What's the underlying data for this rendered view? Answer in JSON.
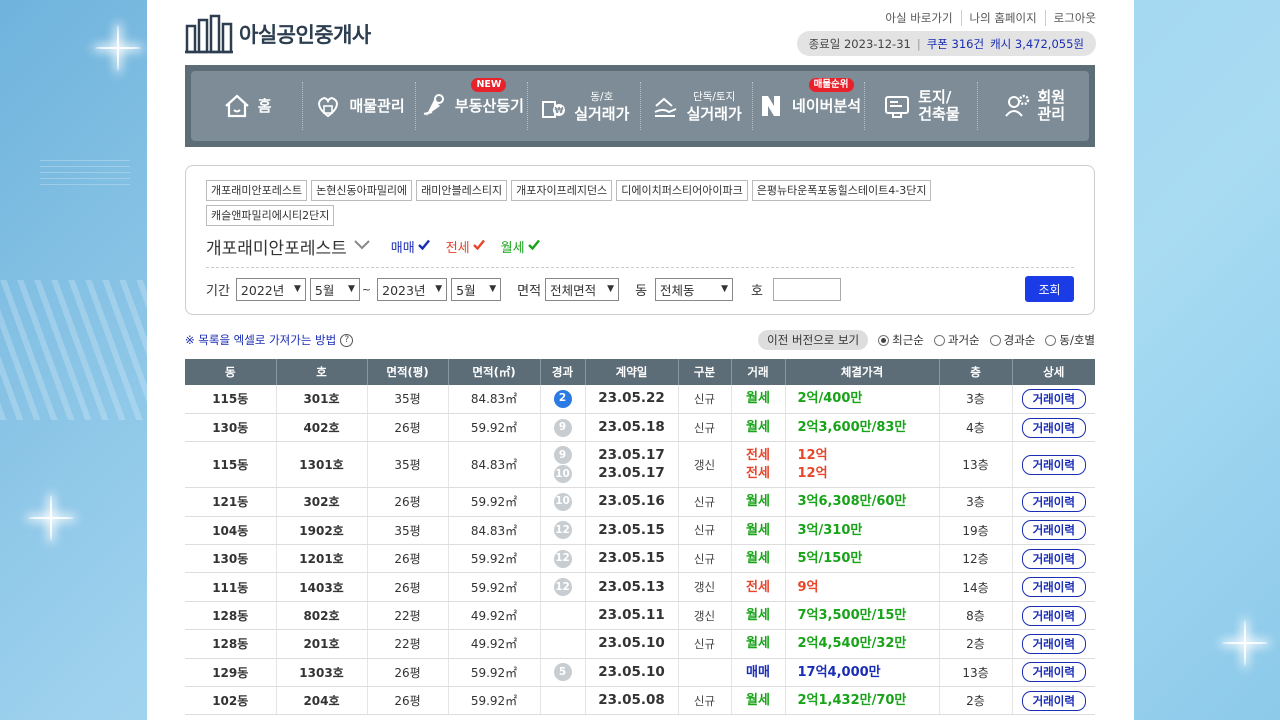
{
  "header": {
    "logo_text": "아실공인중개사",
    "links": [
      "아실 바로가기",
      "나의 홈페이지",
      "로그아웃"
    ],
    "expire_label": "종료일 2023-12-31",
    "coupon": "쿠폰 316건",
    "cash": "캐시 3,472,055원"
  },
  "nav": {
    "items": [
      {
        "label": "홈",
        "icon": "home-icon"
      },
      {
        "label": "매물관리",
        "icon": "house-heart-icon"
      },
      {
        "label": "부동산등기",
        "icon": "registry-icon",
        "badge": "NEW"
      },
      {
        "label": "실거래가",
        "small": "동/호",
        "icon": "building-money-icon"
      },
      {
        "label": "실거래가",
        "small": "단독/토지",
        "icon": "land-hand-icon"
      },
      {
        "label": "네이버분석",
        "icon": "naver-icon",
        "badge": "매물순위"
      },
      {
        "label": "토지/\n건축물",
        "icon": "document-icon"
      },
      {
        "label": "회원\n관리",
        "icon": "member-gear-icon"
      }
    ]
  },
  "filter": {
    "chips": [
      "개포래미안포레스트",
      "논현신동아파밀리에",
      "래미안블레스티지",
      "개포자이프레지던스",
      "디에이치퍼스티어아이파크",
      "은평뉴타운폭포동힐스테이트4-3단지",
      "캐슬앤파밀리에시티2단지"
    ],
    "selected_name": "개포래미안포레스트",
    "trade_types": [
      {
        "label": "매매",
        "color": "#1a2db5"
      },
      {
        "label": "전세",
        "color": "#e8452b"
      },
      {
        "label": "월세",
        "color": "#18a318"
      }
    ],
    "period_label": "기간",
    "from_year": "2022년",
    "from_month": "5월",
    "tilde": "~",
    "to_year": "2023년",
    "to_month": "5월",
    "area_label": "면적",
    "area_value": "전체면적",
    "dong_label": "동",
    "dong_value": "전체동",
    "ho_label": "호",
    "ho_value": "",
    "search_button": "조회"
  },
  "listbar": {
    "excel_link": "※ 목록을 엑셀로 가져가는 방법",
    "prev_version": "이전 버전으로 보기",
    "sorts": [
      {
        "label": "최근순",
        "checked": true
      },
      {
        "label": "과거순",
        "checked": false
      },
      {
        "label": "경과순",
        "checked": false
      },
      {
        "label": "동/호별",
        "checked": false
      }
    ]
  },
  "table": {
    "headers": [
      "동",
      "호",
      "면적(평)",
      "면적(㎡)",
      "경과",
      "계약일",
      "구분",
      "거래",
      "체결가격",
      "층",
      "상세"
    ],
    "detail_label": "거래이력",
    "rows": [
      {
        "dong": "115동",
        "ho": "301호",
        "py": "35평",
        "m2": "84.83㎡",
        "elapsed": [
          "2"
        ],
        "elapsed_blue": true,
        "date": [
          "23.05.22"
        ],
        "gubun": "신규",
        "trade": [
          "월세"
        ],
        "price": [
          "2억/400만"
        ],
        "floor": "3층"
      },
      {
        "dong": "130동",
        "ho": "402호",
        "py": "26평",
        "m2": "59.92㎡",
        "elapsed": [
          "9"
        ],
        "date": [
          "23.05.18"
        ],
        "gubun": "신규",
        "trade": [
          "월세"
        ],
        "price": [
          "2억3,600만/83만"
        ],
        "floor": "4층"
      },
      {
        "dong": "115동",
        "ho": "1301호",
        "py": "35평",
        "m2": "84.83㎡",
        "elapsed": [
          "9",
          "10"
        ],
        "date": [
          "23.05.17",
          "23.05.17"
        ],
        "gubun": "갱신",
        "trade": [
          "전세",
          "전세"
        ],
        "price": [
          "12억",
          "12억"
        ],
        "floor": "13층"
      },
      {
        "dong": "121동",
        "ho": "302호",
        "py": "26평",
        "m2": "59.92㎡",
        "elapsed": [
          "10"
        ],
        "date": [
          "23.05.16"
        ],
        "gubun": "신규",
        "trade": [
          "월세"
        ],
        "price": [
          "3억6,308만/60만"
        ],
        "floor": "3층"
      },
      {
        "dong": "104동",
        "ho": "1902호",
        "py": "35평",
        "m2": "84.83㎡",
        "elapsed": [
          "12"
        ],
        "date": [
          "23.05.15"
        ],
        "gubun": "신규",
        "trade": [
          "월세"
        ],
        "price": [
          "3억/310만"
        ],
        "floor": "19층"
      },
      {
        "dong": "130동",
        "ho": "1201호",
        "py": "26평",
        "m2": "59.92㎡",
        "elapsed": [
          "12"
        ],
        "date": [
          "23.05.15"
        ],
        "gubun": "신규",
        "trade": [
          "월세"
        ],
        "price": [
          "5억/150만"
        ],
        "floor": "12층"
      },
      {
        "dong": "111동",
        "ho": "1403호",
        "py": "26평",
        "m2": "59.92㎡",
        "elapsed": [
          "12"
        ],
        "date": [
          "23.05.13"
        ],
        "gubun": "갱신",
        "trade": [
          "전세"
        ],
        "price": [
          "9억"
        ],
        "floor": "14층"
      },
      {
        "dong": "128동",
        "ho": "802호",
        "py": "22평",
        "m2": "49.92㎡",
        "elapsed": [],
        "date": [
          "23.05.11"
        ],
        "gubun": "갱신",
        "trade": [
          "월세"
        ],
        "price": [
          "7억3,500만/15만"
        ],
        "floor": "8층"
      },
      {
        "dong": "128동",
        "ho": "201호",
        "py": "22평",
        "m2": "49.92㎡",
        "elapsed": [],
        "date": [
          "23.05.10"
        ],
        "gubun": "신규",
        "trade": [
          "월세"
        ],
        "price": [
          "2억4,540만/32만"
        ],
        "floor": "2층"
      },
      {
        "dong": "129동",
        "ho": "1303호",
        "py": "26평",
        "m2": "59.92㎡",
        "elapsed": [
          "5"
        ],
        "date": [
          "23.05.10"
        ],
        "gubun": "",
        "trade": [
          "매매"
        ],
        "price": [
          "17억4,000만"
        ],
        "floor": "13층"
      },
      {
        "dong": "102동",
        "ho": "204호",
        "py": "26평",
        "m2": "59.92㎡",
        "elapsed": [],
        "date": [
          "23.05.08"
        ],
        "gubun": "신규",
        "trade": [
          "월세"
        ],
        "price": [
          "2억1,432만/70만"
        ],
        "floor": "2층"
      }
    ]
  },
  "colors": {
    "nav_bg": "#5d6d78",
    "sale": "#1a2db5",
    "jeonse": "#e8452b",
    "wolse": "#18a318",
    "accent": "#1a3be6"
  }
}
